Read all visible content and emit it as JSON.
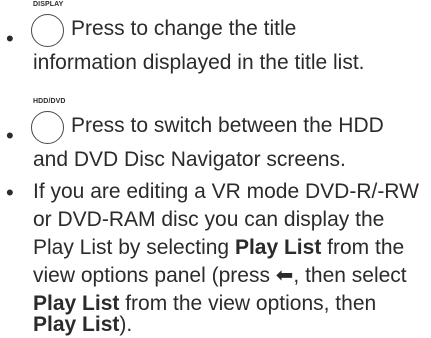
{
  "item1": {
    "button_label": "DISPLAY",
    "line1": "Press to change the title",
    "line2": "information displayed in the title list."
  },
  "item2": {
    "button_label": "HDD/DVD",
    "line1": "Press to switch between the HDD",
    "line2": "and DVD Disc Navigator screens."
  },
  "item3": {
    "line1": "If you are editing a VR mode DVD-R/-RW",
    "line2": "or DVD-RAM disc you can display the",
    "line3_pre": "Play List by selecting ",
    "line3_bold": "Play List",
    "line3_post": "  from the",
    "line4_pre": "view options panel (press ",
    "line4_arrow": "⬅",
    "line4_post": ", then select",
    "line5_bold": "Play List",
    "line5_post": " from the view options, then",
    "line6_bold": "Play List",
    "line6_post": ")."
  },
  "bullet_char": "•"
}
